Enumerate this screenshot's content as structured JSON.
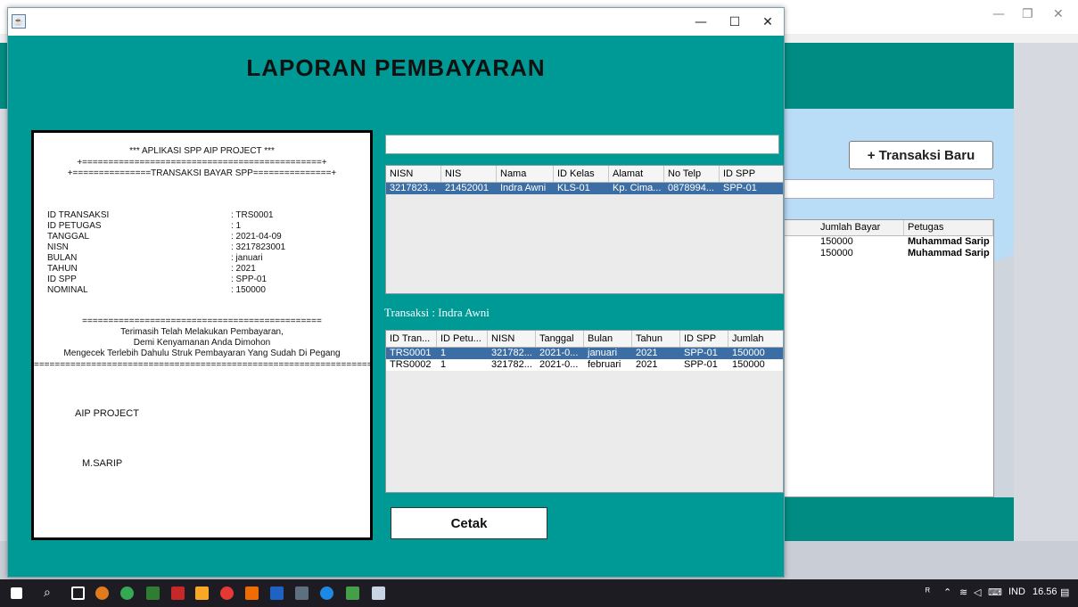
{
  "background": {
    "transaksi_baru_label": "+ Transaksi Baru",
    "table": {
      "headers": [
        "Jumlah Bayar",
        "Petugas"
      ],
      "rows": [
        [
          "150000",
          "Muhammad Sarip"
        ],
        [
          "150000",
          "Muhammad Sarip"
        ]
      ]
    }
  },
  "window": {
    "heading": "LAPORAN PEMBAYARAN"
  },
  "receipt": {
    "title": "*** APLIKASI SPP AIP PROJECT ***",
    "rule1": "+==============================================+",
    "rule2": "+===============TRANSAKSI BAYAR SPP===============+",
    "fields": [
      {
        "key": "ID TRANSAKSI",
        "value": ": TRS0001"
      },
      {
        "key": "ID PETUGAS",
        "value": ": 1"
      },
      {
        "key": "TANGGAL",
        "value": ": 2021-04-09"
      },
      {
        "key": "NISN",
        "value": ": 3217823001"
      },
      {
        "key": "BULAN",
        "value": ": januari"
      },
      {
        "key": "TAHUN",
        "value": ": 2021"
      },
      {
        "key": "ID SPP",
        "value": ": SPP-01"
      },
      {
        "key": "NOMINAL",
        "value": ": 150000"
      }
    ],
    "rule3": "==============================================",
    "msg1": "Terimasih Telah Melakukan Pembayaran,",
    "msg2": "Demi Kenyamanan Anda Dimohon",
    "msg3": "Mengecek Terlebih Dahulu Struk Pembayaran Yang Sudah Di Pegang",
    "rule4": "===================================================================",
    "sig1": "AIP PROJECT",
    "sig2": "M.SARIP"
  },
  "siswa_table": {
    "headers": [
      "NISN",
      "NIS",
      "Nama",
      "ID Kelas",
      "Alamat",
      "No Telp",
      "ID SPP"
    ],
    "rows": [
      [
        "3217823...",
        "21452001",
        "Indra Awni",
        "KLS-01",
        "Kp. Cima...",
        "0878994...",
        "SPP-01"
      ]
    ]
  },
  "transaksi_label": "Transaksi :  Indra Awni",
  "transaksi_table": {
    "headers": [
      "ID Tran...",
      "ID Petu...",
      "NISN",
      "Tanggal",
      "Bulan",
      "Tahun",
      "ID SPP",
      "Jumlah"
    ],
    "rows": [
      [
        "TRS0001",
        "1",
        "321782...",
        "2021-0...",
        "januari",
        "2021",
        "SPP-01",
        "150000"
      ],
      [
        "TRS0002",
        "1",
        "321782...",
        "2021-0...",
        "februari",
        "2021",
        "SPP-01",
        "150000"
      ]
    ]
  },
  "cetak_label": "Cetak",
  "taskbar": {
    "language": "IND",
    "time": "16.56"
  },
  "colors": {
    "teal": "#009a96",
    "selection": "#3b6ea5"
  }
}
